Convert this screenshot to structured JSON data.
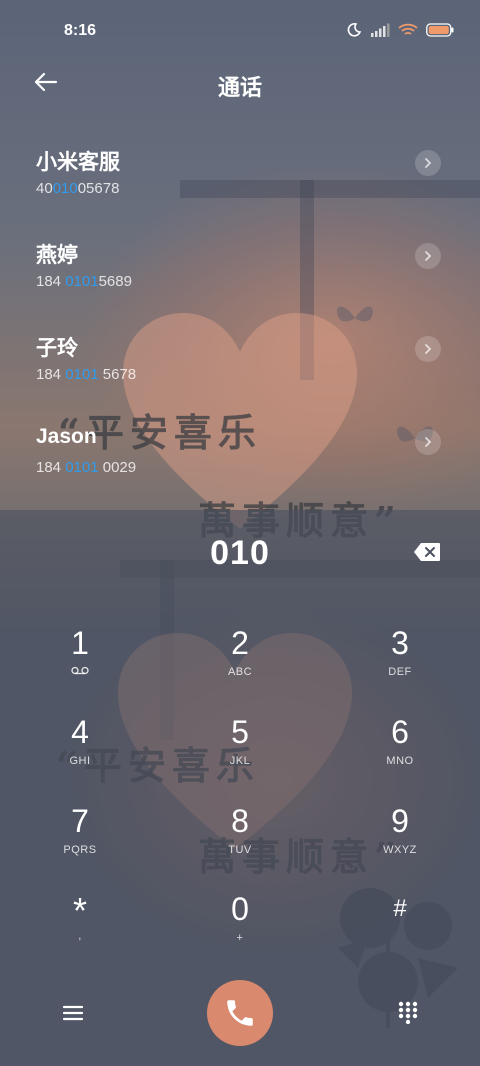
{
  "status_bar": {
    "time": "8:16",
    "icons": [
      "moon-icon",
      "signal-icon",
      "wifi-icon",
      "battery-icon"
    ]
  },
  "header": {
    "title": "通话",
    "back_icon": "back-arrow-icon"
  },
  "contacts": [
    {
      "name": "小米客服",
      "number_pre": "40",
      "number_match": "010",
      "number_post": "05678"
    },
    {
      "name": "燕婷",
      "number_pre": "184 ",
      "number_match": "0101",
      "number_post": "5689"
    },
    {
      "name": "子玲",
      "number_pre": "184 ",
      "number_match": "0101",
      "number_post": " 5678"
    },
    {
      "name": "Jason",
      "number_pre": "184 ",
      "number_match": "0101",
      "number_post": " 0029"
    }
  ],
  "dialer": {
    "typed_number": "010",
    "keys": [
      {
        "digit": "1",
        "letters": ""
      },
      {
        "digit": "2",
        "letters": "ABC"
      },
      {
        "digit": "3",
        "letters": "DEF"
      },
      {
        "digit": "4",
        "letters": "GHI"
      },
      {
        "digit": "5",
        "letters": "JKL"
      },
      {
        "digit": "6",
        "letters": "MNO"
      },
      {
        "digit": "7",
        "letters": "PQRS"
      },
      {
        "digit": "8",
        "letters": "TUV"
      },
      {
        "digit": "9",
        "letters": "WXYZ"
      },
      {
        "digit": "*",
        "letters": ","
      },
      {
        "digit": "0",
        "letters": "+"
      },
      {
        "digit": "#",
        "letters": ""
      }
    ]
  },
  "wallpaper": {
    "text_line1": "“平安喜乐",
    "text_line2": "萬事顺意”"
  },
  "colors": {
    "highlight": "#2f9cf0",
    "call_button": "#d8896e"
  }
}
